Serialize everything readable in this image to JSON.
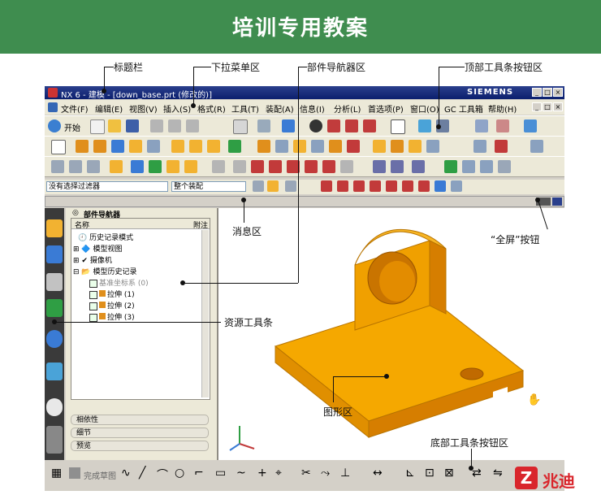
{
  "banner": {
    "title": "培训专用教案",
    "bg_color": "#3f8d4f"
  },
  "callouts": {
    "title_bar": "标题栏",
    "menu_area": "下拉菜单区",
    "part_navigator_area": "部件导航器区",
    "top_toolbar_area": "顶部工具条按钮区",
    "message_area": "消息区",
    "fullscreen_button": "“全屏”按钮",
    "resource_toolbar": "资源工具条",
    "graphics_area": "图形区",
    "bottom_toolbar_area": "底部工具条按钮区"
  },
  "app": {
    "window_title": "NX 6 - 建模 - [down_base.prt (修改的)]",
    "brand": "SIEMENS",
    "menu": [
      "文件(F)",
      "编辑(E)",
      "视图(V)",
      "插入(S)",
      "格式(R)",
      "工具(T)",
      "装配(A)",
      "信息(I)",
      "分析(L)",
      "首选项(P)",
      "窗口(O)",
      "GC 工具箱",
      "帮助(H)"
    ],
    "start_label": "开始",
    "filter_value": "没有选择过滤器",
    "assembly_value": "整个装配",
    "status_text": "完成草图"
  },
  "navigator": {
    "title": "部件导航器",
    "col_name": "名称",
    "col_link": "附注",
    "items": [
      "历史记录模式",
      "模型视图",
      "摄像机",
      "模型历史记录",
      "基准坐标系 (0)",
      "拉伸 (1)",
      "拉伸 (2)",
      "拉伸 (3)"
    ],
    "panels": [
      "相依性",
      "细节",
      "预览"
    ]
  },
  "logo": {
    "text": "兆迪",
    "color": "#d9262c"
  },
  "part": {
    "color": "#f5a800"
  }
}
